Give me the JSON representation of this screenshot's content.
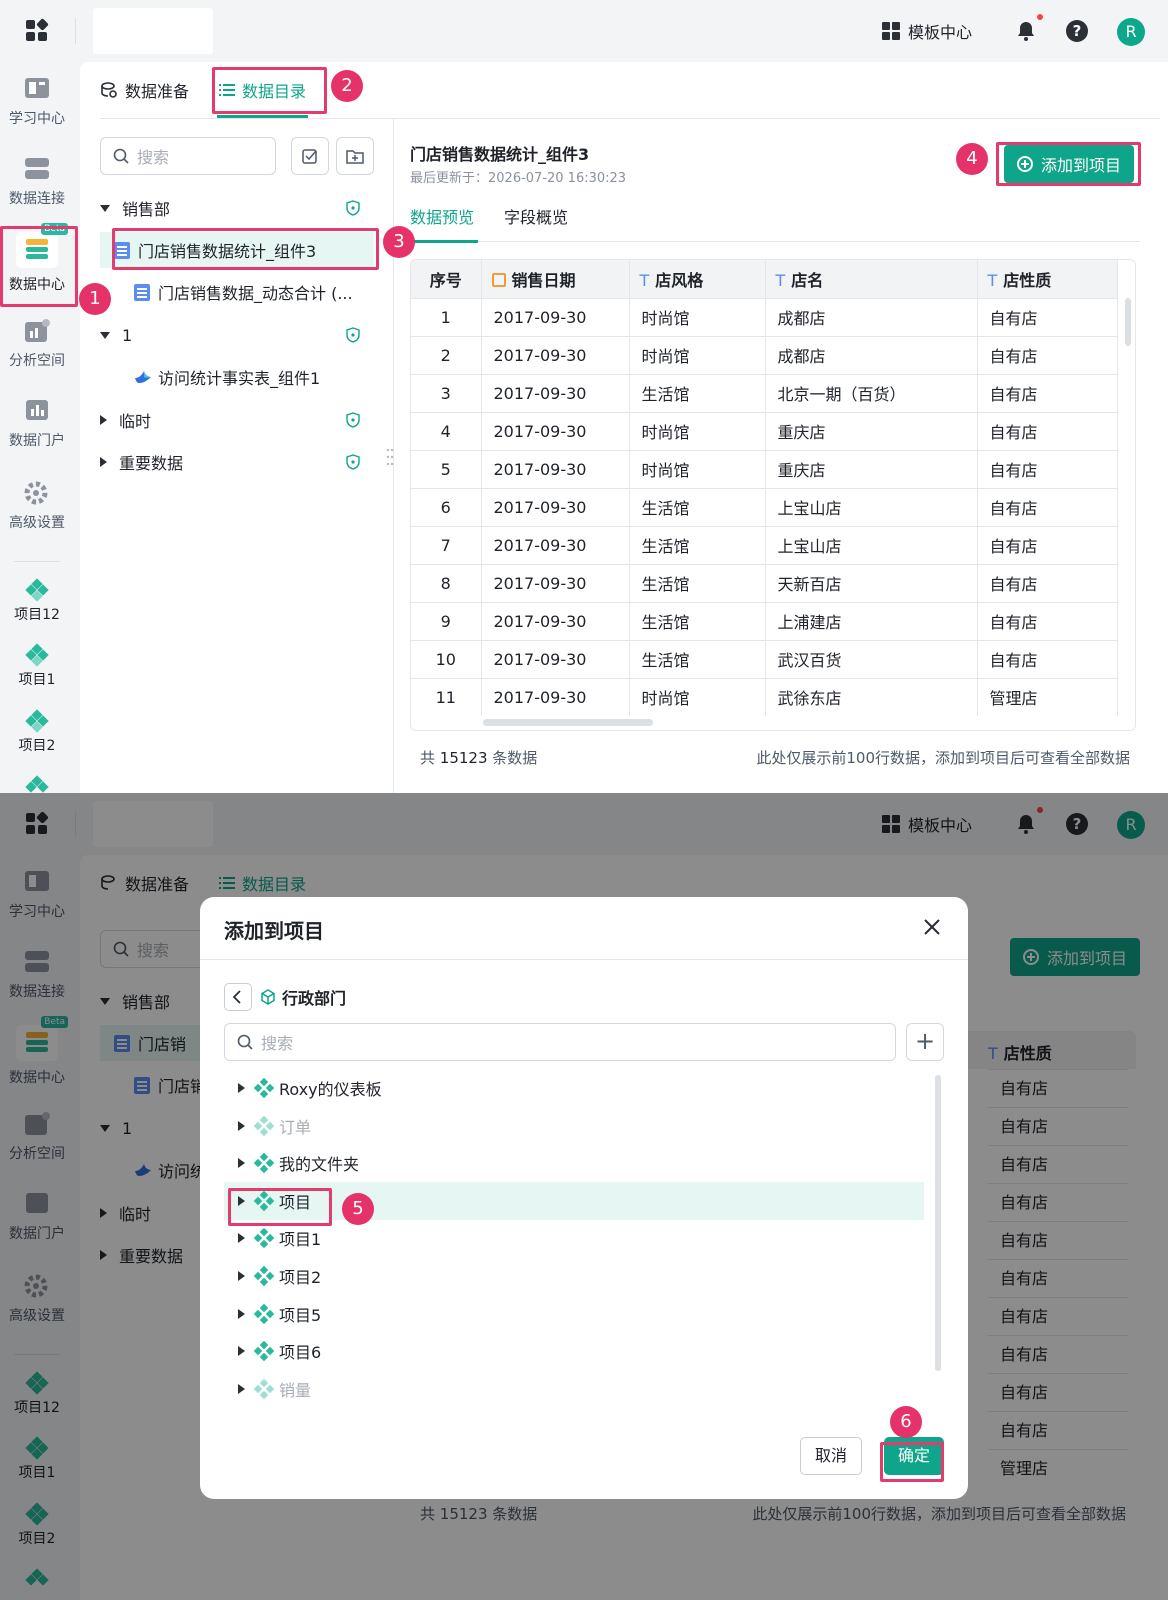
{
  "topbar": {
    "template_center": "模板中心",
    "avatar_letter": "R"
  },
  "sidebar": {
    "items": [
      {
        "label": "学习中心"
      },
      {
        "label": "数据连接"
      },
      {
        "label": "数据中心",
        "badge": "Beta"
      },
      {
        "label": "分析空间"
      },
      {
        "label": "数据门户"
      },
      {
        "label": "高级设置"
      }
    ],
    "projects": [
      "项目12",
      "项目1",
      "项目2"
    ]
  },
  "tabs": {
    "prep": "数据准备",
    "catalog": "数据目录"
  },
  "search": {
    "placeholder": "搜索"
  },
  "tree": {
    "folder1": "销售部",
    "item1": "门店销售数据统计_组件3",
    "item2": "门店销售数据_动态合计 (...",
    "folder2": "1",
    "item3": "访问统计事实表_组件1",
    "folder3": "临时",
    "folder4": "重要数据"
  },
  "detail": {
    "title": "门店销售数据统计_组件3",
    "updated": "最后更新于：2026-07-20 16:30:23",
    "add_button": "添加到项目",
    "tab_preview": "数据预览",
    "tab_fields": "字段概览",
    "columns": [
      "序号",
      "销售日期",
      "店风格",
      "店名",
      "店性质"
    ],
    "rows": [
      [
        "1",
        "2017-09-30",
        "时尚馆",
        "成都店",
        "自有店"
      ],
      [
        "2",
        "2017-09-30",
        "时尚馆",
        "成都店",
        "自有店"
      ],
      [
        "3",
        "2017-09-30",
        "生活馆",
        "北京一期（百货）",
        "自有店"
      ],
      [
        "4",
        "2017-09-30",
        "时尚馆",
        "重庆店",
        "自有店"
      ],
      [
        "5",
        "2017-09-30",
        "时尚馆",
        "重庆店",
        "自有店"
      ],
      [
        "6",
        "2017-09-30",
        "生活馆",
        "上宝山店",
        "自有店"
      ],
      [
        "7",
        "2017-09-30",
        "生活馆",
        "上宝山店",
        "自有店"
      ],
      [
        "8",
        "2017-09-30",
        "生活馆",
        "天新百店",
        "自有店"
      ],
      [
        "9",
        "2017-09-30",
        "生活馆",
        "上浦建店",
        "自有店"
      ],
      [
        "10",
        "2017-09-30",
        "生活馆",
        "武汉百货",
        "自有店"
      ],
      [
        "11",
        "2017-09-30",
        "时尚馆",
        "武徐东店",
        "管理店"
      ]
    ],
    "footer_prefix": "共",
    "footer_count": "15123",
    "footer_suffix": "条数据",
    "footer_note": "此处仅展示前100行数据，添加到项目后可查看全部数据"
  },
  "bg2": {
    "peek_header": "店性质",
    "peek_values": [
      "自有店",
      "自有店",
      "自有店",
      "自有店",
      "自有店",
      "自有店",
      "自有店",
      "自有店",
      "自有店",
      "自有店",
      "管理店"
    ],
    "tree_item1_short": "门店销",
    "tree_item2_short": "门店销",
    "tree_item3_short": "访问统",
    "tree_folder4_short": "重要数据"
  },
  "modal": {
    "title": "添加到项目",
    "crumb": "行政部门",
    "search_placeholder": "搜索",
    "items": [
      {
        "label": "Roxy的仪表板",
        "muted": false
      },
      {
        "label": "订单",
        "muted": true
      },
      {
        "label": "我的文件夹",
        "muted": false
      },
      {
        "label": "项目",
        "muted": false
      },
      {
        "label": "项目1",
        "muted": false
      },
      {
        "label": "项目2",
        "muted": false
      },
      {
        "label": "项目5",
        "muted": false
      },
      {
        "label": "项目6",
        "muted": false
      },
      {
        "label": "销量",
        "muted": true
      }
    ],
    "cancel": "取消",
    "confirm": "确定"
  },
  "steps": [
    "1",
    "2",
    "3",
    "4",
    "5",
    "6"
  ],
  "colors": {
    "accent": "#0fa58a",
    "highlight": "#e33b6d",
    "badge": "#e5336a"
  }
}
